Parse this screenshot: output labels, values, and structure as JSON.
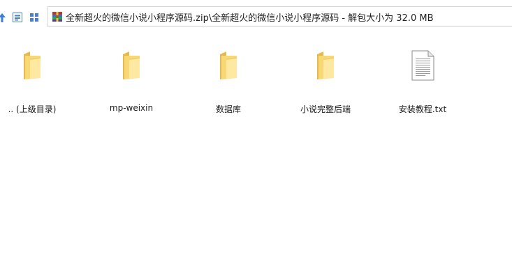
{
  "address_bar": {
    "path": "全新超火的微信小说小程序源码.zip\\全新超火的微信小说小程序源码 - 解包大小为 32.0 MB"
  },
  "toolbar": {
    "buttons": [
      {
        "icon": "up-arrow-icon"
      },
      {
        "icon": "details-view-icon"
      },
      {
        "icon": "grid-view-icon"
      }
    ]
  },
  "files": [
    {
      "name": ".. (上级目录)",
      "type": "folder"
    },
    {
      "name": "mp-weixin",
      "type": "folder"
    },
    {
      "name": "数据库",
      "type": "folder"
    },
    {
      "name": "小说完整后端",
      "type": "folder"
    },
    {
      "name": "安装教程.txt",
      "type": "text-file"
    }
  ],
  "colors": {
    "folder_body": "#f8d775",
    "folder_front": "#ffe9a2",
    "accent_blue": "#3b7ed8"
  }
}
